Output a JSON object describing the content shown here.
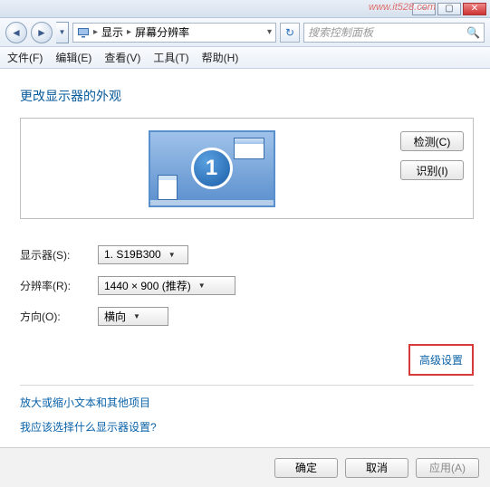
{
  "titlebar": {
    "watermark": "www.it528.com"
  },
  "address": {
    "crumb1": "显示",
    "crumb2": "屏幕分辨率",
    "search_placeholder": "搜索控制面板"
  },
  "menu": {
    "file": "文件(F)",
    "edit": "编辑(E)",
    "view": "查看(V)",
    "tools": "工具(T)",
    "help": "帮助(H)"
  },
  "page": {
    "title": "更改显示器的外观",
    "monitor_number": "1",
    "detect": "检测(C)",
    "identify": "识别(I)"
  },
  "settings": {
    "display_label": "显示器(S):",
    "display_value": "1. S19B300",
    "resolution_label": "分辨率(R):",
    "resolution_value": "1440 × 900 (推荐)",
    "orientation_label": "方向(O):",
    "orientation_value": "横向",
    "advanced_link": "高级设置"
  },
  "extras": {
    "zoom_link": "放大或缩小文本和其他项目",
    "which_link": "我应该选择什么显示器设置?"
  },
  "footer": {
    "ok": "确定",
    "cancel": "取消",
    "apply": "应用(A)"
  }
}
